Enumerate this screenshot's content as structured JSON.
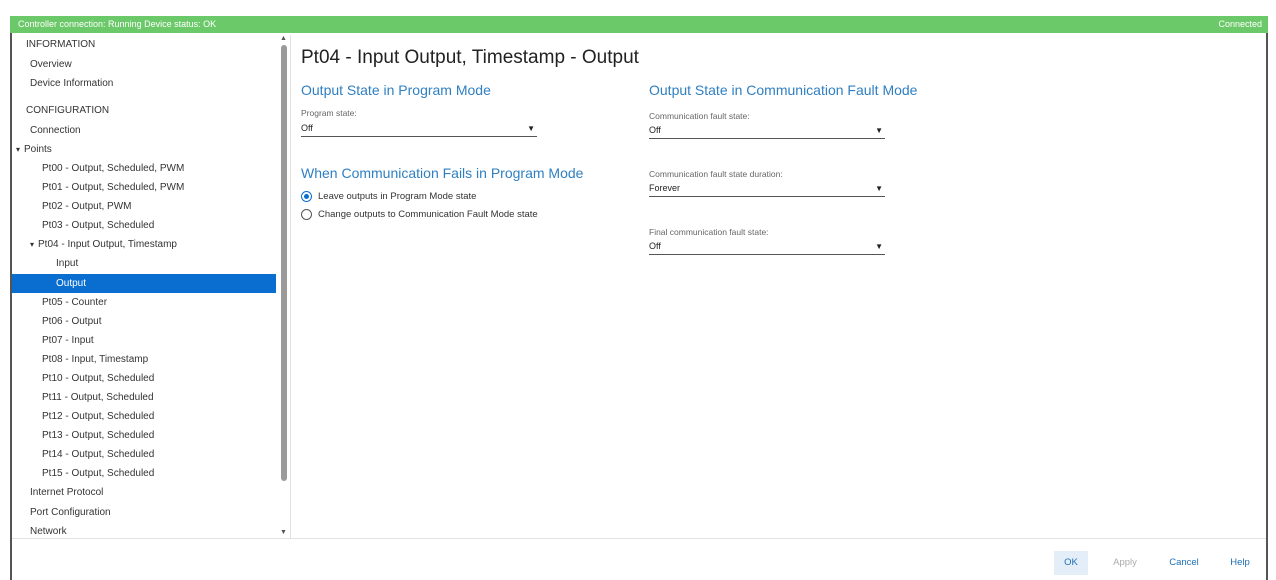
{
  "statusbar": {
    "left_text": "Controller connection: Running   Device status: OK",
    "right_text": "Connected"
  },
  "sidebar": {
    "items": [
      {
        "label": "INFORMATION"
      },
      {
        "label": "Overview"
      },
      {
        "label": "Device Information"
      },
      {
        "label": "CONFIGURATION"
      },
      {
        "label": "Connection"
      },
      {
        "label": "Points"
      },
      {
        "label": "Pt00 - Output, Scheduled, PWM"
      },
      {
        "label": "Pt01 - Output, Scheduled, PWM"
      },
      {
        "label": "Pt02 - Output, PWM"
      },
      {
        "label": "Pt03 - Output, Scheduled"
      },
      {
        "label": "Pt04 - Input Output, Timestamp"
      },
      {
        "label": "Input"
      },
      {
        "label": "Output"
      },
      {
        "label": "Pt05 - Counter"
      },
      {
        "label": "Pt06 - Output"
      },
      {
        "label": "Pt07 - Input"
      },
      {
        "label": "Pt08 - Input, Timestamp"
      },
      {
        "label": "Pt10 - Output, Scheduled"
      },
      {
        "label": "Pt11 - Output, Scheduled"
      },
      {
        "label": "Pt12 - Output, Scheduled"
      },
      {
        "label": "Pt13 - Output, Scheduled"
      },
      {
        "label": "Pt14 - Output, Scheduled"
      },
      {
        "label": "Pt15 - Output, Scheduled"
      },
      {
        "label": "Internet Protocol"
      },
      {
        "label": "Port Configuration"
      },
      {
        "label": "Network"
      }
    ],
    "expand_glyph": "▾",
    "scroll_up_glyph": "▲",
    "scroll_down_glyph": "▼"
  },
  "main": {
    "title": "Pt04 - Input Output, Timestamp - Output",
    "program_mode": {
      "section_title": "Output State in Program Mode",
      "field_label": "Program state:",
      "value": "Off"
    },
    "comm_fails": {
      "section_title": "When Communication Fails in Program Mode",
      "options": [
        {
          "label": "Leave outputs in Program Mode state",
          "checked": true
        },
        {
          "label": "Change outputs to Communication Fault Mode state",
          "checked": false
        }
      ]
    },
    "fault_mode": {
      "section_title": "Output State in Communication Fault Mode",
      "fault_state_label": "Communication fault state:",
      "fault_state_value": "Off",
      "duration_label": "Communication fault state duration:",
      "duration_value": "Forever",
      "final_label": "Final communication fault state:",
      "final_value": "Off"
    },
    "dropdown_arrow": "▼"
  },
  "footer": {
    "ok_label": "OK",
    "apply_label": "Apply",
    "cancel_label": "Cancel",
    "help_label": "Help"
  },
  "colors": {
    "status_green": "#6cc96a",
    "accent_blue": "#0a6ed1",
    "section_blue": "#2f7fc1"
  }
}
